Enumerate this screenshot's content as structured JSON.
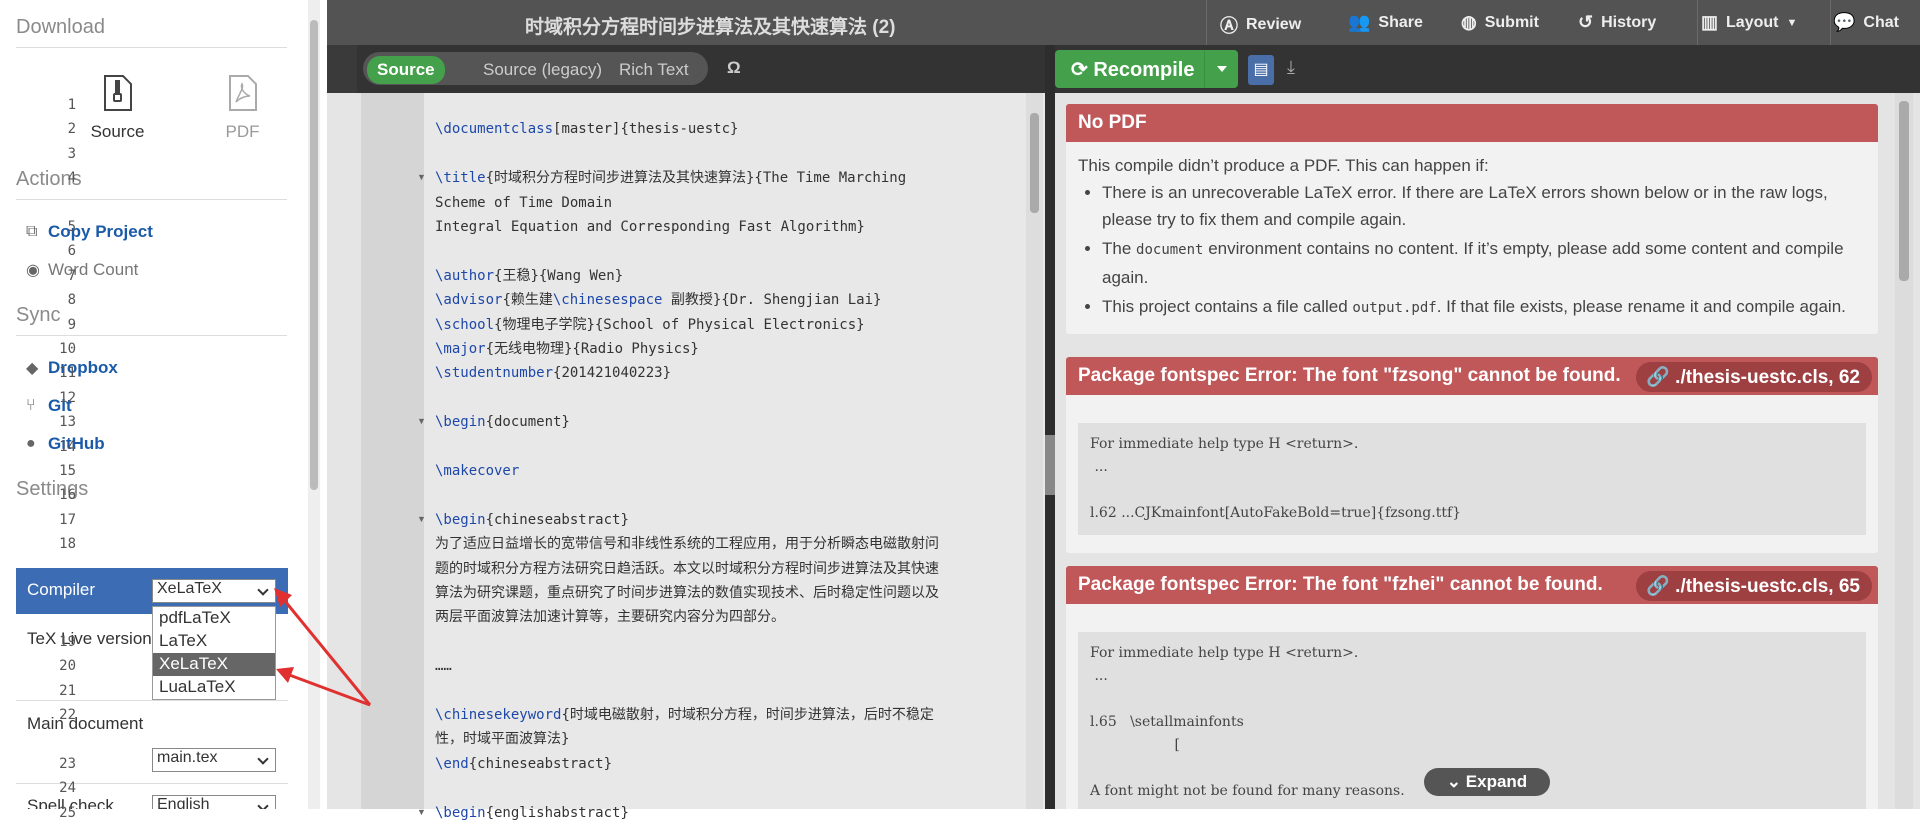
{
  "sidebar": {
    "download_heading": "Download",
    "source_label": "Source",
    "pdf_label": "PDF",
    "actions_heading": "Actions",
    "copy_project": "Copy Project",
    "word_count": "Word Count",
    "sync_heading": "Sync",
    "dropbox": "Dropbox",
    "git": "Git",
    "github": "GitHub",
    "settings_heading": "Settings",
    "compiler_label": "Compiler",
    "compiler_value": "XeLaTeX",
    "compiler_options": [
      "pdfLaTeX",
      "LaTeX",
      "XeLaTeX",
      "LuaLaTeX"
    ],
    "texlive_label": "TeX Live version",
    "main_doc_label": "Main document",
    "main_doc_value": "main.tex",
    "spell_label": "Spell check",
    "spell_value": "English"
  },
  "topbar": {
    "title": "时域积分方程时间步进算法及其快速算法 (2)",
    "review": "Review",
    "share": "Share",
    "submit": "Submit",
    "history": "History",
    "layout": "Layout",
    "chat": "Chat"
  },
  "editor_toolbar": {
    "source": "Source",
    "source_legacy": "Source (legacy)",
    "rich_text": "Rich Text",
    "omega": "Ω"
  },
  "code_lines": [
    {
      "n": "1",
      "t": ""
    },
    {
      "n": "2",
      "t": "\\documentclass[master]{thesis-uestc}"
    },
    {
      "n": "3",
      "t": ""
    },
    {
      "n": "4",
      "t": "\\title{时域积分方程时间步进算法及其快速算法}{The Time Marching"
    },
    {
      "n": "",
      "t": "Scheme of Time Domain"
    },
    {
      "n": "5",
      "t": "    Integral Equation and Corresponding Fast Algorithm}"
    },
    {
      "n": "6",
      "t": ""
    },
    {
      "n": "7",
      "t": "\\author{王稳}{Wang Wen}"
    },
    {
      "n": "8",
      "t": "\\advisor{赖生建\\chinesespace 副教授}{Dr. Shengjian Lai}"
    },
    {
      "n": "9",
      "t": "\\school{物理电子学院}{School of Physical Electronics}"
    },
    {
      "n": "10",
      "t": "\\major{无线电物理}{Radio Physics}"
    },
    {
      "n": "11",
      "t": "\\studentnumber{201421040223}"
    },
    {
      "n": "12",
      "t": ""
    },
    {
      "n": "13",
      "t": "\\begin{document}"
    },
    {
      "n": "14",
      "t": ""
    },
    {
      "n": "15",
      "t": "\\makecover"
    },
    {
      "n": "16",
      "t": ""
    },
    {
      "n": "17",
      "t": "\\begin{chineseabstract}"
    },
    {
      "n": "18",
      "t": "为了适应日益增长的宽带信号和非线性系统的工程应用，用于分析瞬态电磁散射问"
    },
    {
      "n": "",
      "t": "题的时域积分方程方法研究日趋活跃。本文以时域积分方程时间步进算法及其快速"
    },
    {
      "n": "",
      "t": "算法为研究课题，重点研究了时间步进算法的数值实现技术、后时稳定性问题以及"
    },
    {
      "n": "",
      "t": "两层平面波算法加速计算等，主要研究内容分为四部分。"
    },
    {
      "n": "19",
      "t": ""
    },
    {
      "n": "20",
      "t": "……"
    },
    {
      "n": "21",
      "t": ""
    },
    {
      "n": "22",
      "t": "\\chinesekeyword{时域电磁散射，时域积分方程，时间步进算法，后时不稳定"
    },
    {
      "n": "",
      "t": "性，时域平面波算法}"
    },
    {
      "n": "23",
      "t": "\\end{chineseabstract}"
    },
    {
      "n": "24",
      "t": ""
    },
    {
      "n": "25",
      "t": "\\begin{englishabstract}"
    }
  ],
  "pdf_toolbar": {
    "recompile": "Recompile"
  },
  "no_pdf": {
    "title": "No PDF",
    "intro": "This compile didn’t produce a PDF. This can happen if:",
    "b1": "There is an unrecoverable LaTeX error. If there are LaTeX errors shown below or in the raw logs, please try to fix them and compile again.",
    "b2_a": "The ",
    "b2_code": "document",
    "b2_b": " environment contains no content. If it’s empty, please add some content and compile again.",
    "b3_a": "This project contains a file called ",
    "b3_code": "output.pdf",
    "b3_b": ". If that file exists, please rename it and compile again."
  },
  "errors": [
    {
      "title": "Package fontspec Error: The font \"fzsong\" cannot be found.",
      "file": "./thesis-uestc.cls, 62",
      "log": "For immediate help type H <return>.\n ...\n\nl.62 ...CJKmainfont[AutoFakeBold=true]{fzsong.ttf}"
    },
    {
      "title": "Package fontspec Error: The font \"fzhei\" cannot be found.",
      "file": "./thesis-uestc.cls, 65",
      "log": "For immediate help type H <return>.\n ...\n\nl.65   \\setallmainfonts\n                   [\n\nA font might not be found for many reasons."
    }
  ],
  "expand": "Expand",
  "colors": {
    "accent_green": "#44a04a",
    "error_red": "#c0585a",
    "link_blue": "#1a5aa8",
    "topbar": "#535353"
  }
}
